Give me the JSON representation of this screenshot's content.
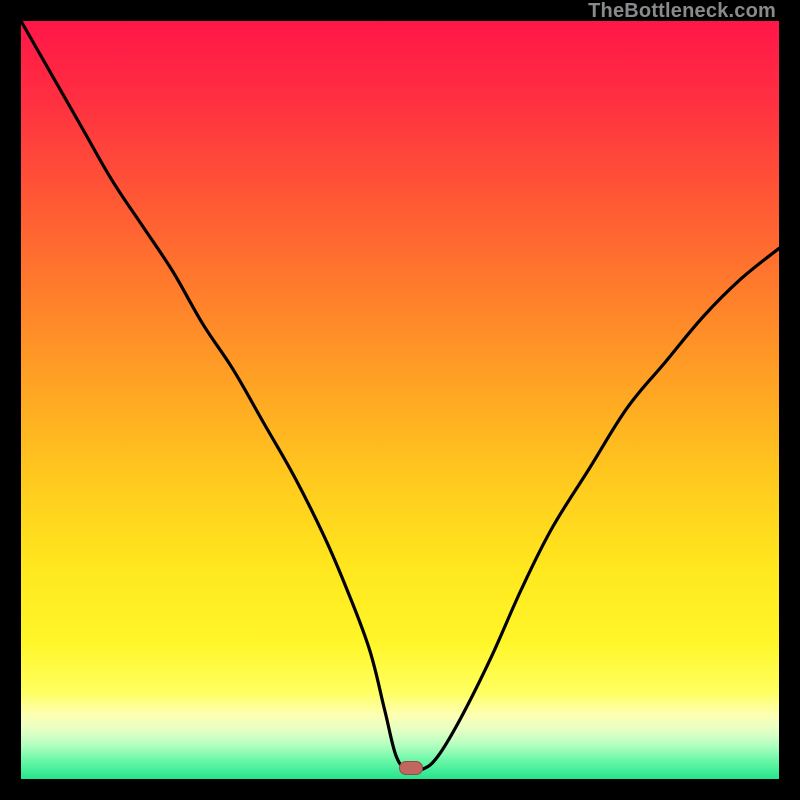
{
  "watermark": {
    "text": "TheBottleneck.com"
  },
  "marker": {
    "x_pct": 51.5,
    "y_pct": 98.6,
    "color": "#c1675f"
  },
  "gradient": {
    "stops": [
      {
        "offset": 0.0,
        "color": "#ff1648"
      },
      {
        "offset": 0.1,
        "color": "#ff2e41"
      },
      {
        "offset": 0.22,
        "color": "#ff5336"
      },
      {
        "offset": 0.35,
        "color": "#ff7b2c"
      },
      {
        "offset": 0.48,
        "color": "#ffa324"
      },
      {
        "offset": 0.6,
        "color": "#ffc81e"
      },
      {
        "offset": 0.72,
        "color": "#ffe71e"
      },
      {
        "offset": 0.82,
        "color": "#fff629"
      },
      {
        "offset": 0.885,
        "color": "#ffff60"
      },
      {
        "offset": 0.915,
        "color": "#fdffb2"
      },
      {
        "offset": 0.935,
        "color": "#e6ffc4"
      },
      {
        "offset": 0.955,
        "color": "#b3ffc0"
      },
      {
        "offset": 0.975,
        "color": "#6cf7a8"
      },
      {
        "offset": 1.0,
        "color": "#24e58c"
      }
    ]
  },
  "chart_data": {
    "type": "line",
    "title": "",
    "xlabel": "",
    "ylabel": "",
    "xlim": [
      0,
      100
    ],
    "ylim": [
      0,
      100
    ],
    "annotations": [
      "TheBottleneck.com"
    ],
    "series": [
      {
        "name": "bottleneck-curve",
        "x": [
          0,
          4,
          8,
          12,
          16,
          20,
          24,
          28,
          32,
          36,
          40,
          43,
          46,
          48,
          49.5,
          51,
          53,
          55,
          58,
          62,
          66,
          70,
          75,
          80,
          85,
          90,
          95,
          100
        ],
        "y": [
          100,
          93,
          86,
          79,
          73,
          67,
          60,
          54,
          47,
          40,
          32,
          25,
          17,
          9,
          3,
          1.3,
          1.3,
          3,
          8,
          16,
          25,
          33,
          41,
          49,
          55,
          61,
          66,
          70
        ]
      }
    ],
    "marker": {
      "x": 51.5,
      "y": 1.4
    }
  }
}
